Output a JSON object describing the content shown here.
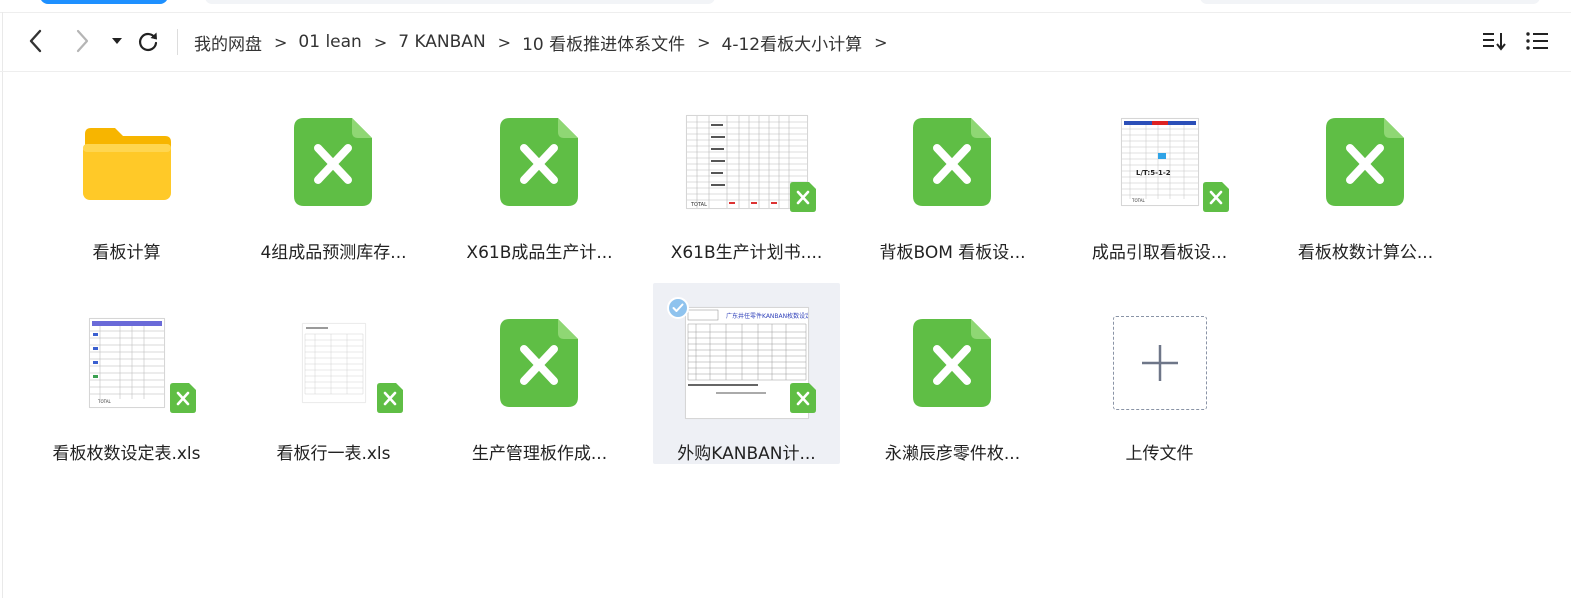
{
  "toolbar": {
    "back_icon": "chevron-left-icon",
    "forward_icon": "chevron-right-icon",
    "history_icon": "caret-down-icon",
    "refresh_icon": "refresh-icon",
    "sort_icon": "sort-icon",
    "list_view_icon": "list-view-icon",
    "breadcrumb": [
      "我的网盘",
      "01 lean",
      "7 KANBAN",
      "10 看板推进体系文件",
      "4-12看板大小计算"
    ],
    "separator": ">"
  },
  "files": [
    {
      "name": "看板计算",
      "type": "folder"
    },
    {
      "name": "4组成品预测库存...",
      "type": "xls-icon"
    },
    {
      "name": "X61B成品生产计...",
      "type": "xls-icon"
    },
    {
      "name": "X61B生产计划书....",
      "type": "xls-thumb"
    },
    {
      "name": "背板BOM 看板设...",
      "type": "xls-icon"
    },
    {
      "name": "成品引取看板设...",
      "type": "xls-thumb"
    },
    {
      "name": "看板枚数计算公...",
      "type": "xls-icon"
    },
    {
      "name": "看板枚数设定表.xls",
      "type": "xls-thumb"
    },
    {
      "name": "看板行一表.xls",
      "type": "xls-thumb"
    },
    {
      "name": "生产管理板作成...",
      "type": "xls-icon"
    },
    {
      "name": "外购KANBAN计...",
      "type": "xls-thumb",
      "selected": true
    },
    {
      "name": "永濑辰彦零件枚...",
      "type": "xls-icon"
    },
    {
      "name": "上传文件",
      "type": "upload"
    }
  ],
  "thumb_text": {
    "production_total": "TOTAL",
    "finished_lt": "L/T:5-1-2",
    "finished_total": "TOTAL",
    "setting_total": "TOTAL",
    "purchase_title": "广东井任零件KANBAN枚数设定表"
  },
  "colors": {
    "accent": "#1e90ff",
    "excel_green": "#5fbe45",
    "folder_yellow": "#ffc928",
    "selected_bg": "#eef0f5"
  }
}
